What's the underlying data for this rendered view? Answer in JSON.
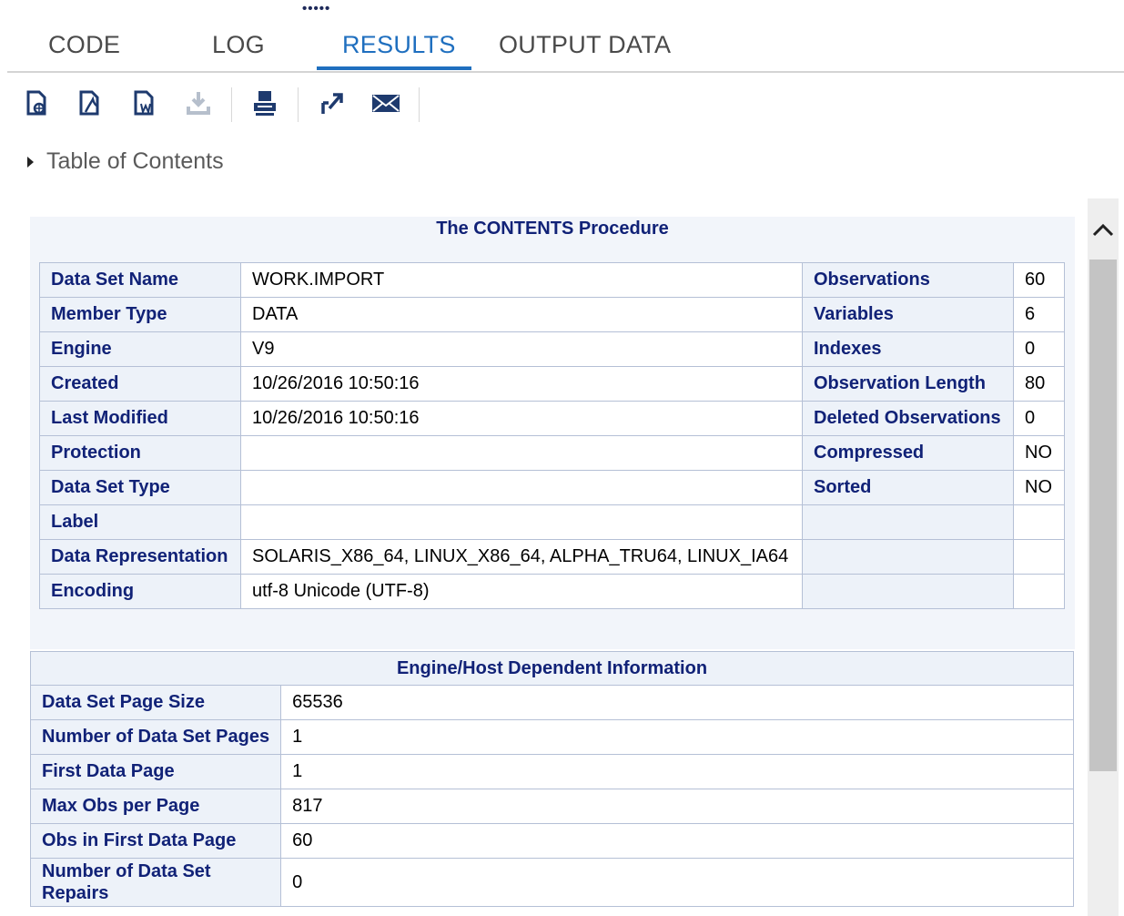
{
  "tabs": [
    {
      "label": "CODE"
    },
    {
      "label": "LOG"
    },
    {
      "label": "RESULTS"
    },
    {
      "label": "OUTPUT DATA"
    }
  ],
  "toolbar": {
    "icons": [
      "download-html-icon",
      "download-pdf-icon",
      "download-word-icon",
      "download-icon",
      "print-icon",
      "open-new-window-icon",
      "email-icon"
    ]
  },
  "toc": {
    "label": "Table of Contents"
  },
  "contents": {
    "title": "The CONTENTS Procedure",
    "rows": [
      {
        "k1": "Data Set Name",
        "v1": "WORK.IMPORT",
        "k2": "Observations",
        "v2": "60"
      },
      {
        "k1": "Member Type",
        "v1": "DATA",
        "k2": "Variables",
        "v2": "6"
      },
      {
        "k1": "Engine",
        "v1": "V9",
        "k2": "Indexes",
        "v2": "0"
      },
      {
        "k1": "Created",
        "v1": "10/26/2016 10:50:16",
        "k2": "Observation Length",
        "v2": "80"
      },
      {
        "k1": "Last Modified",
        "v1": "10/26/2016 10:50:16",
        "k2": "Deleted Observations",
        "v2": "0"
      },
      {
        "k1": "Protection",
        "v1": "",
        "k2": "Compressed",
        "v2": "NO"
      },
      {
        "k1": "Data Set Type",
        "v1": "",
        "k2": "Sorted",
        "v2": "NO"
      },
      {
        "k1": "Label",
        "v1": "",
        "k2": "",
        "v2": ""
      },
      {
        "k1": "Data Representation",
        "v1": "SOLARIS_X86_64, LINUX_X86_64, ALPHA_TRU64, LINUX_IA64",
        "k2": "",
        "v2": ""
      },
      {
        "k1": "Encoding",
        "v1": "utf-8 Unicode (UTF-8)",
        "k2": "",
        "v2": ""
      }
    ]
  },
  "engine": {
    "title": "Engine/Host Dependent Information",
    "rows": [
      {
        "k": "Data Set Page Size",
        "v": "65536"
      },
      {
        "k": "Number of Data Set Pages",
        "v": "1"
      },
      {
        "k": "First Data Page",
        "v": "1"
      },
      {
        "k": "Max Obs per Page",
        "v": "817"
      },
      {
        "k": "Obs in First Data Page",
        "v": "60"
      },
      {
        "k": "Number of Data Set Repairs",
        "v": "0"
      }
    ]
  },
  "colors": {
    "accent": "#1f6fbf",
    "header_text": "#112277"
  }
}
